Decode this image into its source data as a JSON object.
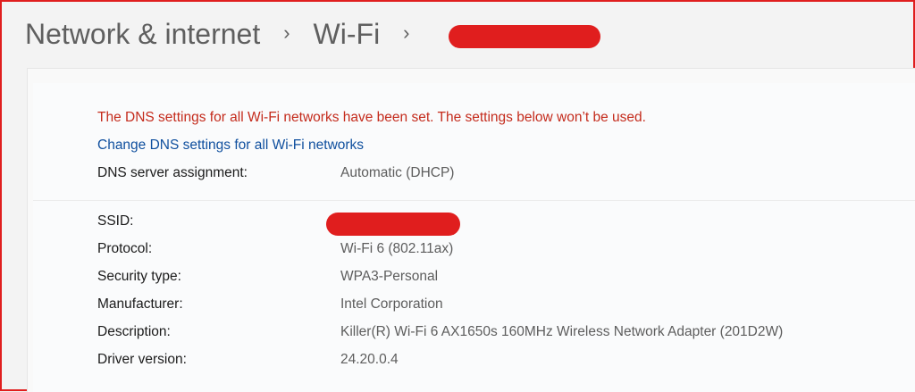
{
  "breadcrumb": {
    "items": [
      "Network & internet",
      "Wi-Fi"
    ],
    "separator": "›"
  },
  "warning_text": "The DNS settings for all Wi-Fi networks have been set. The settings below won’t be used.",
  "change_dns_link": "Change DNS settings for all Wi-Fi networks",
  "dns": {
    "label": "DNS server assignment:",
    "value": "Automatic (DHCP)"
  },
  "properties": [
    {
      "label": "SSID:",
      "value": ""
    },
    {
      "label": "Protocol:",
      "value": "Wi-Fi 6 (802.11ax)"
    },
    {
      "label": "Security type:",
      "value": "WPA3-Personal"
    },
    {
      "label": "Manufacturer:",
      "value": "Intel Corporation"
    },
    {
      "label": "Description:",
      "value": "Killer(R) Wi-Fi 6 AX1650s 160MHz Wireless Network Adapter (201D2W)"
    },
    {
      "label": "Driver version:",
      "value": "24.20.0.4"
    }
  ],
  "colors": {
    "warning": "#c42b1c",
    "link": "#0f4f9e",
    "redaction": "#e01e1e",
    "frame_border": "#e01e1e"
  }
}
